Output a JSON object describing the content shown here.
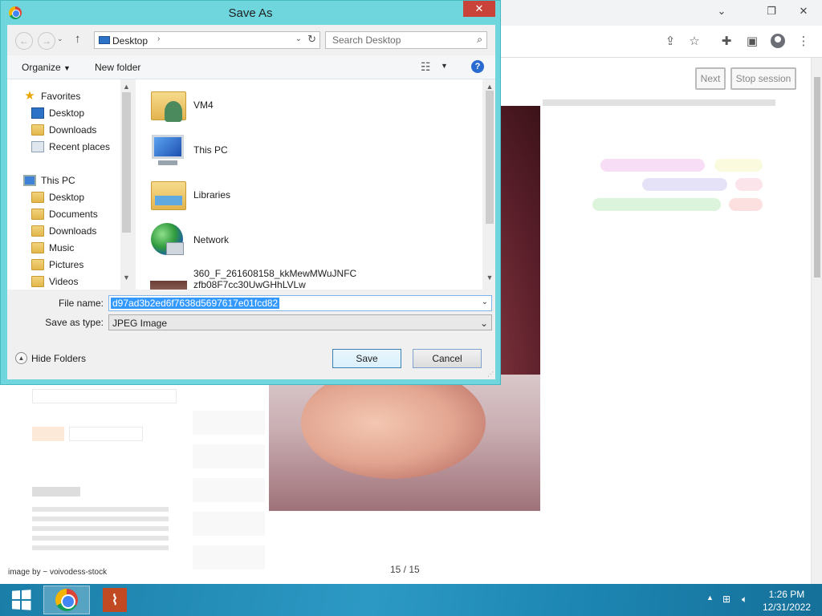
{
  "browser": {
    "nav_next": "Next",
    "nav_stop": "Stop session"
  },
  "page": {
    "image_credit": "image by ~ voivodess-stock",
    "slide_counter": "15 / 15"
  },
  "dialog": {
    "title": "Save As",
    "close": "✕",
    "address": "Desktop",
    "search_placeholder": "Search Desktop",
    "organize": "Organize",
    "new_folder": "New folder",
    "nav_groups": [
      {
        "label": "Favorites",
        "icon": "star-icon"
      },
      {
        "label": "Desktop",
        "icon": "desktop-icon"
      },
      {
        "label": "Downloads",
        "icon": "folder-icon"
      },
      {
        "label": "Recent places",
        "icon": "recent-places-icon"
      },
      {
        "label": "This PC",
        "icon": "computer-icon"
      },
      {
        "label": "Desktop",
        "icon": "folder-icon"
      },
      {
        "label": "Documents",
        "icon": "folder-icon"
      },
      {
        "label": "Downloads",
        "icon": "folder-icon"
      },
      {
        "label": "Music",
        "icon": "folder-icon"
      },
      {
        "label": "Pictures",
        "icon": "folder-icon"
      },
      {
        "label": "Videos",
        "icon": "folder-icon"
      }
    ],
    "files": [
      {
        "label": "VM4",
        "icon": "user-folder-icon"
      },
      {
        "label": "This PC",
        "icon": "computer-icon"
      },
      {
        "label": "Libraries",
        "icon": "libraries-icon"
      },
      {
        "label": "Network",
        "icon": "network-icon"
      },
      {
        "label": "360_F_261608158_kkMewMWuJNFC",
        "label2": "zfb08F7cc30UwGHhLVLw",
        "icon": "image-thumbnail-icon"
      }
    ],
    "file_name_label": "File name:",
    "file_name_value": "d97ad3b2ed6f7638d5697617e01fcd82",
    "save_type_label": "Save as type:",
    "save_type_value": "JPEG Image",
    "hide_folders": "Hide Folders",
    "save_button": "Save",
    "cancel_button": "Cancel"
  },
  "taskbar": {
    "time": "1:26 PM",
    "date": "12/31/2022"
  },
  "colors": {
    "dialog_frame": "#6fd6de",
    "selection": "#3399ff",
    "taskbar": "#2c99c4",
    "close_button": "#c9433a"
  }
}
